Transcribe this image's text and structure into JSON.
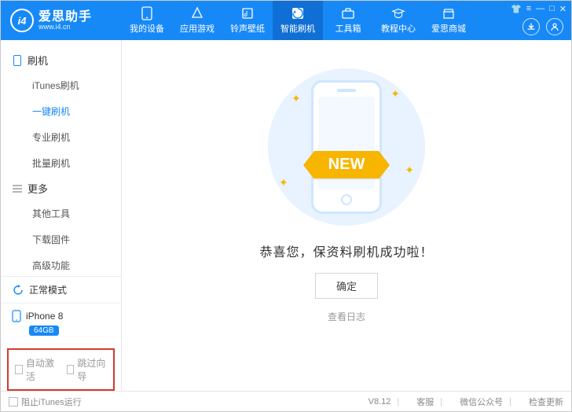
{
  "app": {
    "logo_mark": "i4",
    "title": "爱思助手",
    "subtitle": "www.i4.cn"
  },
  "top_nav": [
    {
      "label": "我的设备",
      "icon": "phone-icon"
    },
    {
      "label": "应用游戏",
      "icon": "apps-icon"
    },
    {
      "label": "铃声壁纸",
      "icon": "music-icon"
    },
    {
      "label": "智能刷机",
      "icon": "flash-icon",
      "active": true
    },
    {
      "label": "工具箱",
      "icon": "toolbox-icon"
    },
    {
      "label": "教程中心",
      "icon": "tutorials-icon"
    },
    {
      "label": "爱思商城",
      "icon": "store-icon"
    }
  ],
  "sidebar": {
    "groups": [
      {
        "title": "刷机",
        "icon": "phone-small-icon",
        "items": [
          {
            "label": "iTunes刷机"
          },
          {
            "label": "一键刷机",
            "active": true
          },
          {
            "label": "专业刷机"
          },
          {
            "label": "批量刷机"
          }
        ]
      },
      {
        "title": "更多",
        "icon": "menu-icon",
        "items": [
          {
            "label": "其他工具"
          },
          {
            "label": "下载固件"
          },
          {
            "label": "高级功能"
          }
        ]
      }
    ],
    "mode": {
      "label": "正常模式"
    },
    "device": {
      "name": "iPhone 8",
      "storage": "64GB"
    },
    "checks": [
      {
        "label": "自动激活"
      },
      {
        "label": "跳过向导"
      }
    ]
  },
  "main": {
    "ribbon": "NEW",
    "result": "恭喜您，保资料刷机成功啦！",
    "ok": "确定",
    "log": "查看日志"
  },
  "footer": {
    "block_itunes": "阻止iTunes运行",
    "version": "V8.12",
    "links": [
      "客服",
      "微信公众号",
      "检查更新"
    ]
  }
}
